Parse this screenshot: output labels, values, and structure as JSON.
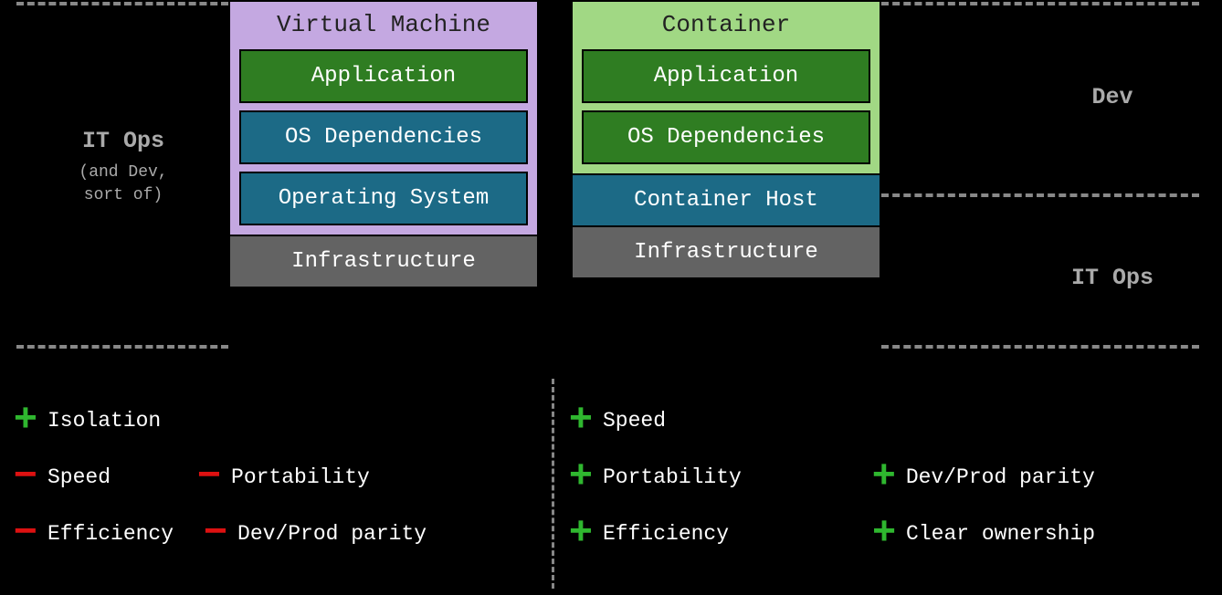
{
  "vm": {
    "title": "Virtual Machine",
    "layers": {
      "app": "Application",
      "deps": "OS Dependencies",
      "os": "Operating System",
      "infra": "Infrastructure"
    }
  },
  "container": {
    "title": "Container",
    "layers": {
      "app": "Application",
      "deps": "OS Dependencies",
      "host": "Container Host",
      "infra": "Infrastructure"
    }
  },
  "left_label": {
    "main": "IT Ops",
    "sub1": "(and Dev,",
    "sub2": "sort of)"
  },
  "right_labels": {
    "dev": "Dev",
    "itops": "IT Ops"
  },
  "vm_points": {
    "r1a": "Isolation",
    "r2a": "Speed",
    "r2b": "Portability",
    "r3a": "Efficiency",
    "r3b": "Dev/Prod parity"
  },
  "ct_points": {
    "r1a": "Speed",
    "r2a": "Portability",
    "r2b": "Dev/Prod parity",
    "r3a": "Efficiency",
    "r3b": "Clear ownership"
  },
  "signs": {
    "plus": "+",
    "minus": "−"
  }
}
